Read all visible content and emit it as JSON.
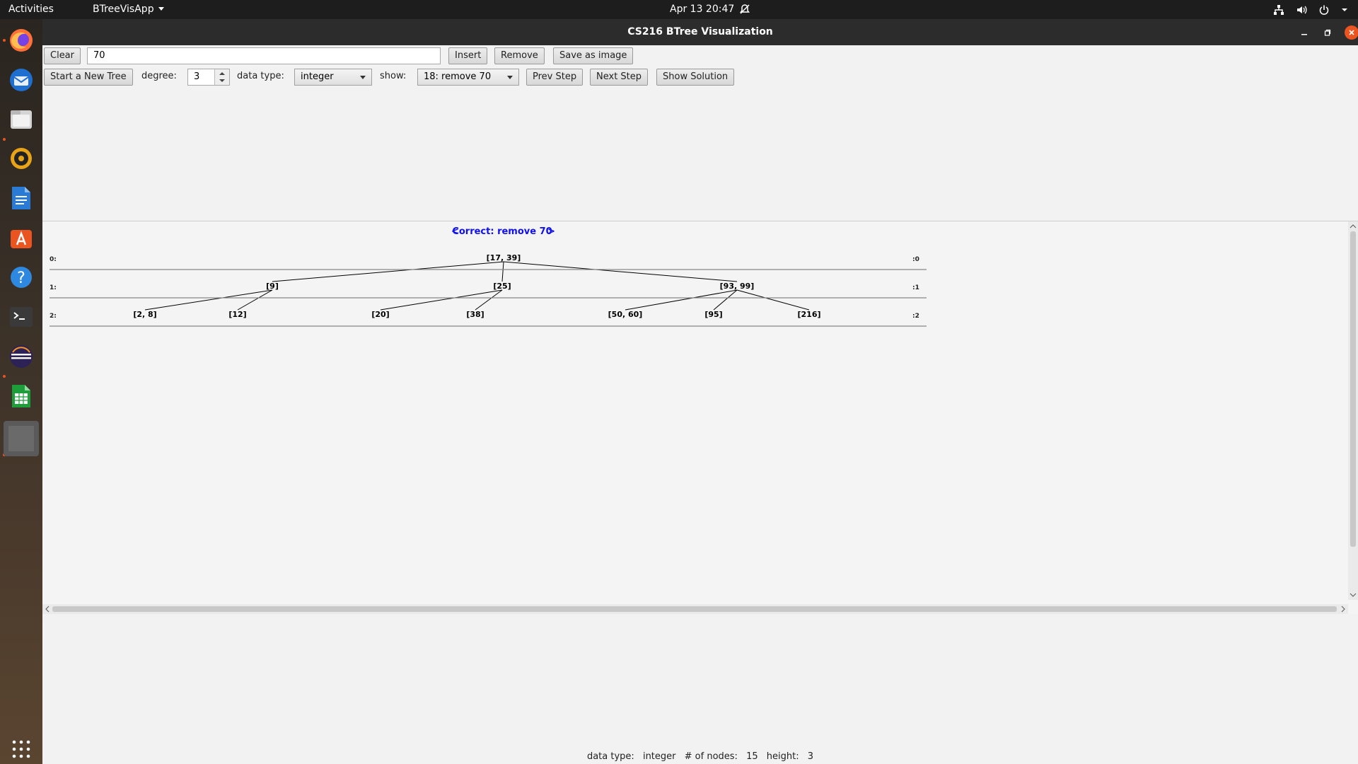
{
  "topbar": {
    "activities": "Activities",
    "app_menu": "BTreeVisApp",
    "clock": "Apr 13  20:47"
  },
  "dock": {
    "items": [
      "firefox-icon",
      "thunderbird-icon",
      "files-icon",
      "rhythmbox-icon",
      "writer-icon",
      "software-icon",
      "help-icon",
      "terminal-icon",
      "eclipse-icon",
      "calc-icon",
      "app-window-icon"
    ],
    "show_apps": "show-apps-icon"
  },
  "window": {
    "title": "CS216 BTree Visualization"
  },
  "toolbar": {
    "clear_label": "Clear",
    "input_value": "70",
    "insert_label": "Insert",
    "remove_label": "Remove",
    "save_label": "Save as image",
    "new_tree_label": "Start a New Tree",
    "degree_label": "degree:",
    "degree_value": "3",
    "datatype_label": "data type:",
    "datatype_value": "integer",
    "show_label": "show:",
    "show_value": "18: remove 70",
    "prev_label": "Prev Step",
    "next_label": "Next Step",
    "solution_label": "Show Solution"
  },
  "tree": {
    "heading_prev": "<",
    "heading_text": "Correct: remove 70",
    "heading_next": ">",
    "levels": [
      {
        "left": "0:",
        "right": ":0",
        "nodes": [
          "[17, 39]"
        ]
      },
      {
        "left": "1:",
        "right": ":1",
        "nodes": [
          "[9]",
          "[25]",
          "[93, 99]"
        ]
      },
      {
        "left": "2:",
        "right": ":2",
        "nodes": [
          "[2, 8]",
          "[12]",
          "[20]",
          "[38]",
          "[50, 60]",
          "[95]",
          "[216]"
        ]
      }
    ],
    "edges": [
      [
        0,
        0,
        1,
        0
      ],
      [
        0,
        0,
        1,
        1
      ],
      [
        0,
        0,
        1,
        2
      ],
      [
        1,
        0,
        2,
        0
      ],
      [
        1,
        0,
        2,
        1
      ],
      [
        1,
        1,
        2,
        2
      ],
      [
        1,
        1,
        2,
        3
      ],
      [
        1,
        2,
        2,
        4
      ],
      [
        1,
        2,
        2,
        5
      ],
      [
        1,
        2,
        2,
        6
      ]
    ]
  },
  "status": {
    "datatype_label": "data type:",
    "datatype_value": "integer",
    "nodes_label": "# of nodes:",
    "nodes_value": "15",
    "height_label": "height:",
    "height_value": "3"
  }
}
